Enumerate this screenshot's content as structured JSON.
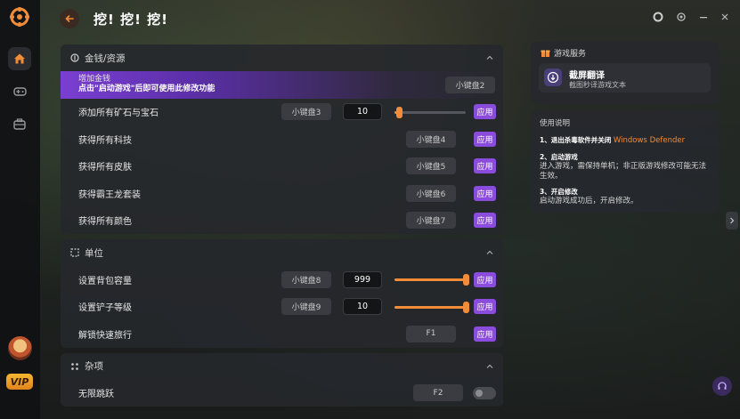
{
  "header": {
    "title": "挖! 挖! 挖!"
  },
  "colors": {
    "accent": "#8b4bdc",
    "orange": "#f28c38",
    "panel": "#26282c"
  },
  "rail": {
    "vip_label": "VIP"
  },
  "sections": [
    {
      "title": "金钱/资源",
      "rows": [
        {
          "label": "增加金钱",
          "hint": "点击\"启动游戏\"后即可使用此修改功能",
          "key": "小键盘2"
        },
        {
          "label": "添加所有矿石与宝石",
          "key": "小键盘3",
          "value": "10",
          "slider": 0.05,
          "apply": "应用"
        },
        {
          "label": "获得所有科技",
          "key": "小键盘4",
          "apply": "应用"
        },
        {
          "label": "获得所有皮肤",
          "key": "小键盘5",
          "apply": "应用"
        },
        {
          "label": "获得霸王龙套装",
          "key": "小键盘6",
          "apply": "应用"
        },
        {
          "label": "获得所有颜色",
          "key": "小键盘7",
          "apply": "应用"
        }
      ]
    },
    {
      "title": "单位",
      "rows": [
        {
          "label": "设置背包容量",
          "key": "小键盘8",
          "value": "999",
          "slider": 1.0,
          "apply": "应用"
        },
        {
          "label": "设置铲子等级",
          "key": "小键盘9",
          "value": "10",
          "slider": 1.0,
          "apply": "应用"
        },
        {
          "label": "解锁快速旅行",
          "key": "F1",
          "apply": "应用"
        }
      ]
    },
    {
      "title": "杂项",
      "rows": [
        {
          "label": "无限跳跃",
          "key": "F2"
        }
      ]
    }
  ],
  "service": {
    "title": "游戏服务",
    "name": "截屏翻译",
    "desc": "截图秒译游戏文本"
  },
  "instructions": {
    "title": "使用说明",
    "steps": [
      {
        "head": "1、退出杀毒软件并关闭",
        "head_highlight": "Windows Defender",
        "body": ""
      },
      {
        "head": "2、启动游戏",
        "body": "进入游戏，需保持单机；非正版游戏修改可能无法生效。"
      },
      {
        "head": "3、开启修改",
        "body": "启动游戏成功后，开启修改。"
      }
    ]
  }
}
